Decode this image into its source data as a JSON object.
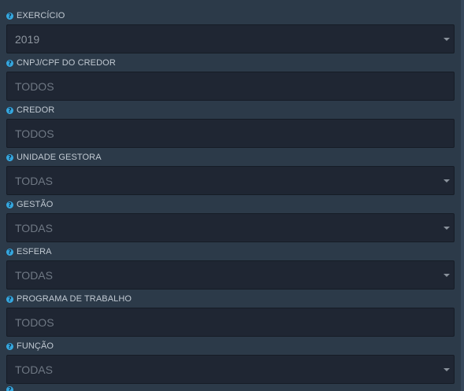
{
  "filters": [
    {
      "label": "EXERCÍCIO",
      "value": "2019",
      "control": "select",
      "icon": "help-icon"
    },
    {
      "label": "CNPJ/CPF DO CREDOR",
      "placeholder": "TODOS",
      "control": "input",
      "icon": "help-icon"
    },
    {
      "label": "CREDOR",
      "placeholder": "TODOS",
      "control": "input",
      "icon": "help-icon"
    },
    {
      "label": "UNIDADE GESTORA",
      "value": "TODAS",
      "control": "select",
      "icon": "help-icon"
    },
    {
      "label": "GESTÃO",
      "value": "TODAS",
      "control": "select",
      "icon": "help-icon"
    },
    {
      "label": "ESFERA",
      "value": "TODAS",
      "control": "select",
      "icon": "help-icon"
    },
    {
      "label": "PROGRAMA DE TRABALHO",
      "placeholder": "TODOS",
      "control": "input",
      "icon": "help-icon"
    },
    {
      "label": "FUNÇÃO",
      "value": "TODAS",
      "control": "select",
      "icon": "help-icon"
    }
  ],
  "help_glyph": "?",
  "colors": {
    "background": "#2c3a49",
    "field_background": "#1f2633",
    "help_icon": "#35a8e0",
    "label_text": "#c1c9d2",
    "value_text": "#8d959f",
    "placeholder_text": "#6f7884"
  }
}
